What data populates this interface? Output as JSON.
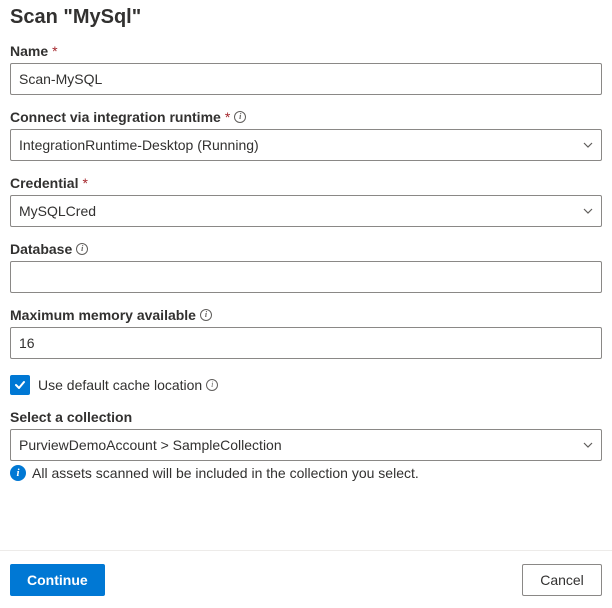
{
  "title": "Scan \"MySql\"",
  "fields": {
    "name": {
      "label": "Name",
      "value": "Scan-MySQL"
    },
    "runtime": {
      "label": "Connect via integration runtime",
      "value": "IntegrationRuntime-Desktop (Running)"
    },
    "credential": {
      "label": "Credential",
      "value": "MySQLCred"
    },
    "database": {
      "label": "Database",
      "value": ""
    },
    "memory": {
      "label": "Maximum memory available",
      "value": "16"
    },
    "cache": {
      "label": "Use default cache location",
      "checked": true
    },
    "collection": {
      "label": "Select a collection",
      "value": "PurviewDemoAccount > SampleCollection",
      "hint": "All assets scanned will be included in the collection you select."
    }
  },
  "footer": {
    "continue": "Continue",
    "cancel": "Cancel"
  }
}
